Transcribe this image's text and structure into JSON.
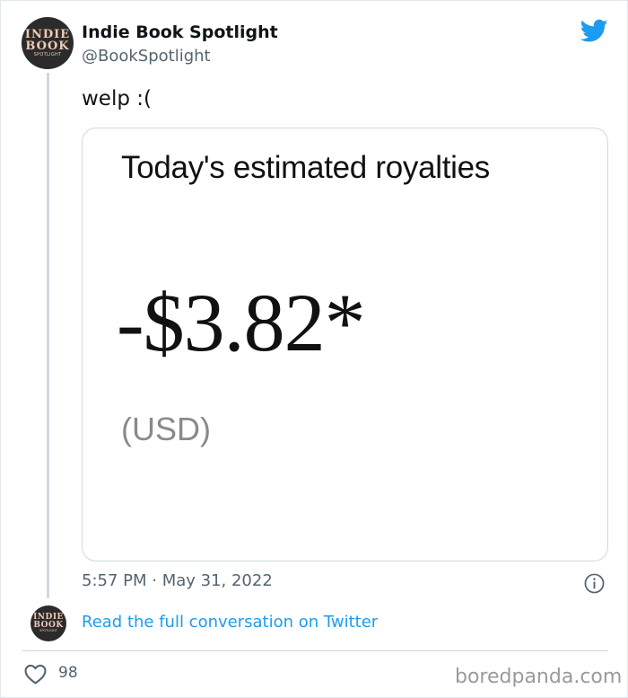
{
  "author": {
    "display_name": "Indie Book Spotlight",
    "handle": "@BookSpotlight",
    "avatar_text": [
      "INDIE",
      "BOOK",
      "SPOTLIGHT"
    ]
  },
  "tweet": {
    "text": "welp :(",
    "timestamp": "5:57 PM · May 31, 2022"
  },
  "media": {
    "heading": "Today's estimated royalties",
    "amount": "-$3.82*",
    "currency": "(USD)"
  },
  "footer": {
    "read_link": "Read the full conversation on Twitter",
    "like_count": "98",
    "watermark": "boredpanda.com"
  },
  "icons": {
    "brand": "twitter-bird-icon",
    "info": "info-icon",
    "like": "heart-icon"
  },
  "colors": {
    "twitter_blue": "#1d9bf0",
    "secondary_text": "#536471",
    "border": "#cfd9de"
  }
}
